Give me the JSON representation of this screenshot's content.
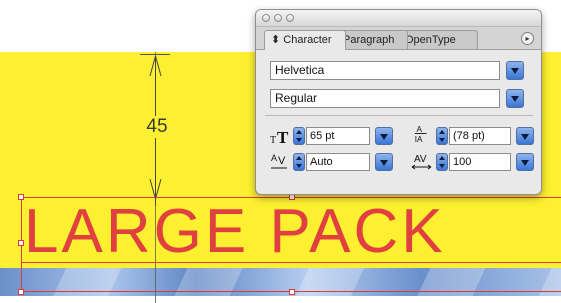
{
  "artboard": {
    "dimension_label": "45",
    "headline": "LARGE PACK"
  },
  "panel": {
    "tabs": [
      "⬍ Character",
      "Paragraph",
      "OpenType"
    ],
    "font_family": "Helvetica",
    "font_style": "Regular",
    "font_size": "65 pt",
    "leading": "(78 pt)",
    "kerning": "Auto",
    "tracking": "100",
    "icons": {
      "font_size": "font-size-icon",
      "leading": "leading-icon",
      "kerning": "kerning-icon",
      "tracking": "tracking-icon"
    }
  },
  "colors": {
    "artboard_yellow": "#fdf030",
    "headline_red": "#e04040",
    "selection_red": "#d93a3a",
    "dropdown_blue": "#3a76d8"
  }
}
